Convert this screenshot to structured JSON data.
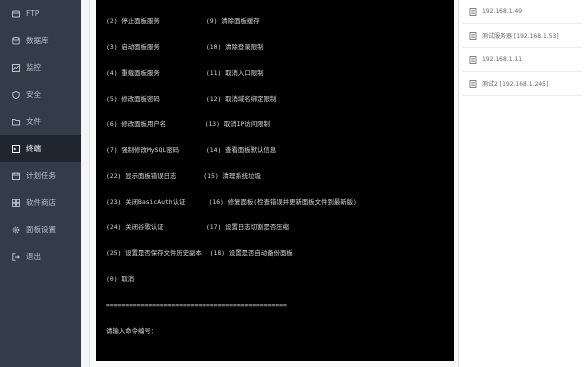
{
  "sidebar": {
    "items": [
      {
        "label": "FTP",
        "icon": "ftp-icon"
      },
      {
        "label": "数据库",
        "icon": "database-icon"
      },
      {
        "label": "监控",
        "icon": "monitor-icon"
      },
      {
        "label": "安全",
        "icon": "shield-icon"
      },
      {
        "label": "文件",
        "icon": "folder-icon"
      },
      {
        "label": "终端",
        "icon": "terminal-icon",
        "active": true
      },
      {
        "label": "计划任务",
        "icon": "calendar-icon"
      },
      {
        "label": "软件商店",
        "icon": "store-icon"
      },
      {
        "label": "面板设置",
        "icon": "gear-icon"
      },
      {
        "label": "退出",
        "icon": "logout-icon"
      }
    ]
  },
  "terminal": {
    "lines": [
      "(2) 停止面板服务            (9) 清除面板缓存",
      "(3) 启动面板服务            (10) 清除登录限制",
      "(4) 重载面板服务            (11) 取消入口限制",
      "(5) 修改面板密码            (12) 取消域名绑定限制",
      "(6) 修改面板用户名          (13) 取消IP访问限制",
      "(7) 强制修改MySQL密码       (14) 查看面板默认信息",
      "(22) 显示面板错误日志       (15) 清理系统垃圾",
      "(23) 关闭BasicAuth认证      (16) 修复面板(检查错误并更新面板文件到最新版)",
      "(24) 关闭谷歌认证           (17) 设置日志切割是否压缩",
      "(25) 设置是否保存文件历史副本  (18) 设置是否自动备份面板",
      "(0) 取消",
      "===============================================",
      "请输入命令编号："
    ]
  },
  "hosts": {
    "items": [
      {
        "label": "192.168.1.49"
      },
      {
        "label": "测试服务器 [192.168.1.53]"
      },
      {
        "label": "192.168.1.11"
      },
      {
        "label": "测试2 [192.168.1.245]"
      }
    ]
  }
}
